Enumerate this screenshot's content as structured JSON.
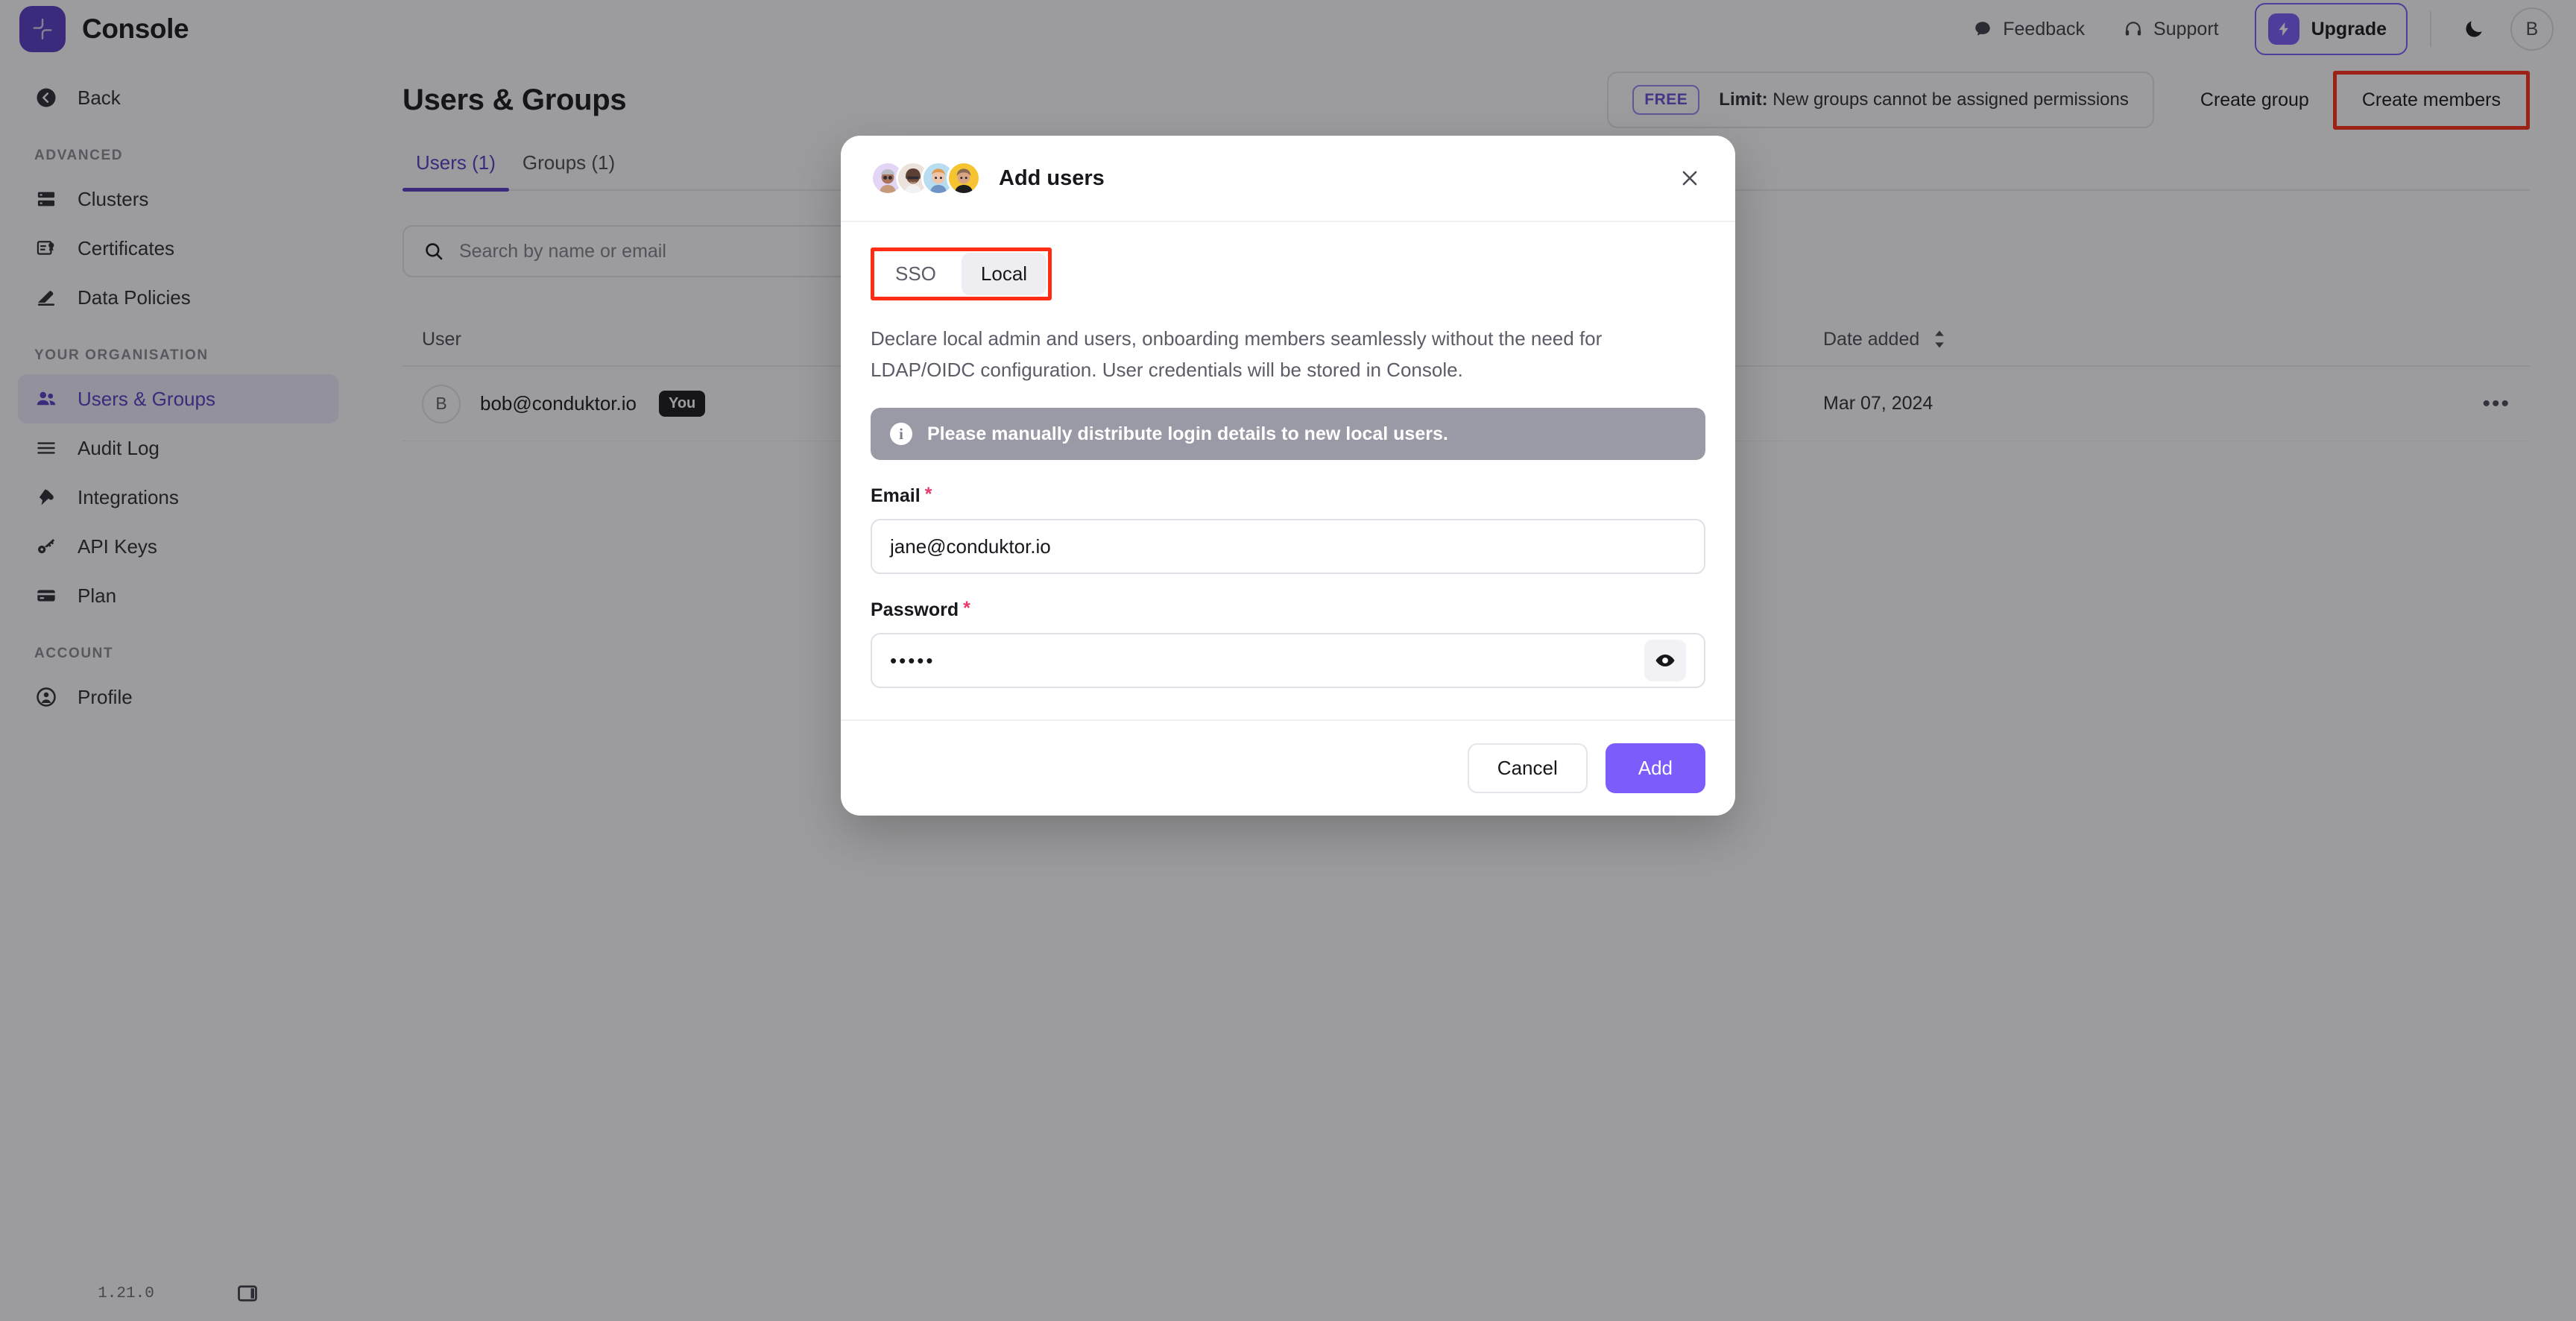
{
  "app": {
    "brand_name": "Console",
    "version": "1.21.0"
  },
  "topbar": {
    "feedback_label": "Feedback",
    "support_label": "Support",
    "upgrade_label": "Upgrade",
    "user_initial": "B",
    "icons": {
      "feedback": "chat-bubble-icon",
      "support": "headset-icon",
      "upgrade": "lightning-bolt-icon",
      "theme": "moon-icon"
    }
  },
  "sidebar": {
    "back_label": "Back",
    "section_advanced": "ADVANCED",
    "section_organisation": "YOUR ORGANISATION",
    "section_account": "ACCOUNT",
    "items_advanced": [
      {
        "label": "Clusters",
        "icon": "server-icon"
      },
      {
        "label": "Certificates",
        "icon": "certificate-icon"
      },
      {
        "label": "Data Policies",
        "icon": "shield-pen-icon"
      }
    ],
    "items_organisation": [
      {
        "label": "Users & Groups",
        "icon": "users-icon",
        "active": true
      },
      {
        "label": "Audit Log",
        "icon": "list-icon",
        "active": false
      },
      {
        "label": "Integrations",
        "icon": "plug-icon",
        "active": false
      },
      {
        "label": "API Keys",
        "icon": "key-icon",
        "active": false
      },
      {
        "label": "Plan",
        "icon": "credit-card-icon",
        "active": false
      }
    ],
    "items_account": [
      {
        "label": "Profile",
        "icon": "user-circle-icon"
      }
    ]
  },
  "page": {
    "title": "Users & Groups",
    "free_badge": "FREE",
    "limit_prefix": "Limit:",
    "limit_text": "New groups cannot be assigned permissions",
    "create_group_label": "Create group",
    "create_members_label": "Create members"
  },
  "tabs": [
    {
      "label": "Users (1)",
      "active": true
    },
    {
      "label": "Groups (1)",
      "active": false
    }
  ],
  "search": {
    "placeholder": "Search by name or email",
    "value": ""
  },
  "table": {
    "columns": [
      "User",
      "Date added"
    ],
    "rows": [
      {
        "avatar_initial": "B",
        "email": "bob@conduktor.io",
        "badge": "You",
        "date_added": "Mar 07, 2024",
        "menu": "•••"
      }
    ]
  },
  "modal": {
    "title": "Add users",
    "close_label": "×",
    "avatars": [
      {
        "bg": "#e3d5f5",
        "skin": "#a9725a",
        "hair": "#b9bcc4"
      },
      {
        "bg": "#ece2dc",
        "skin": "#7a4d3b",
        "hair": "#5c4034"
      },
      {
        "bg": "#b8dcf0",
        "skin": "#f0c4a8",
        "hair": "#e09a4e"
      },
      {
        "bg": "#f5c430",
        "skin": "#d9a583",
        "hair": "#1d1d1f"
      }
    ],
    "tabs": [
      {
        "label": "SSO",
        "active": false
      },
      {
        "label": "Local",
        "active": true
      }
    ],
    "description": "Declare local admin and users, onboarding members seamlessly without the need for LDAP/OIDC configuration. User credentials will be stored in Console.",
    "info_banner": "Please manually distribute login details to new local users.",
    "fields": {
      "email_label": "Email",
      "email_value": "jane@conduktor.io",
      "email_required": "*",
      "password_label": "Password",
      "password_value": "•••••",
      "password_required": "*",
      "show_password_icon": "eye-icon"
    },
    "cancel_label": "Cancel",
    "add_label": "Add"
  },
  "colors": {
    "brand_purple": "#5b3bc4",
    "accent_purple": "#7c5cfa",
    "highlight_red": "#ff2d16",
    "required_red": "#e8396a",
    "banner_gray": "#9a9aa6"
  }
}
